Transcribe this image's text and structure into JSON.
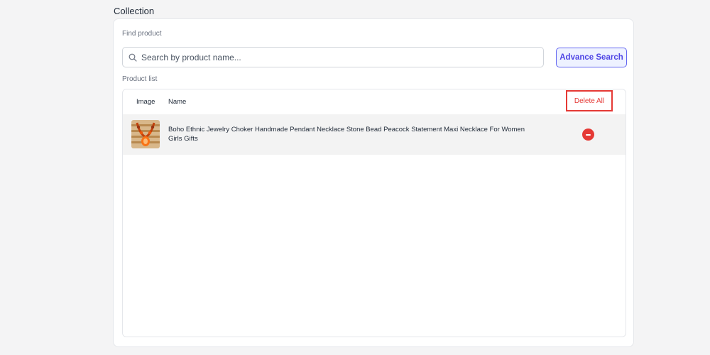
{
  "page": {
    "title": "Collection"
  },
  "find_product": {
    "label": "Find product",
    "search_placeholder": "Search by product name...",
    "search_value": "",
    "advance_search_label": "Advance Search"
  },
  "product_list": {
    "label": "Product list",
    "columns": {
      "image": "Image",
      "name": "Name"
    },
    "delete_all_label": "Delete All",
    "items": [
      {
        "name": "Boho Ethnic Jewelry Choker Handmade Pendant Necklace Stone Bead Peacock Statement Maxi Necklace For Women Girls Gifts",
        "image_icon": "necklace-thumbnail",
        "remove_icon": "minus-circle-icon"
      }
    ]
  },
  "colors": {
    "accent": "#4f46e5",
    "danger": "#e53935",
    "background": "#f4f4f5"
  }
}
